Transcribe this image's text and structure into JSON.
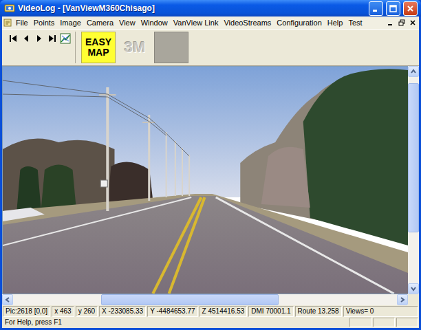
{
  "window": {
    "title": "VideoLog - [VanViewM360Chisago]"
  },
  "menu": [
    "File",
    "Points",
    "Image",
    "Camera",
    "View",
    "Window",
    "VanView Link",
    "VideoStreams",
    "Configuration",
    "Help",
    "Test"
  ],
  "toolbar_buttons": [
    {
      "label": "EASY MAP",
      "kind": "highlight"
    },
    {
      "label": "3M",
      "kind": "logo"
    },
    {
      "label": "",
      "kind": "blank"
    }
  ],
  "vertical_scrollbar": {
    "start": 0.03,
    "level": 0.72
  },
  "horizontal_scrollbar": {
    "start": 0.23,
    "level": 0.46
  },
  "status_bar": {
    "fields": [
      "Pic:2618 [0,0]",
      "x 463",
      "y 260",
      "X -233085.33",
      "Y -4484653.77",
      "Z 4514416.53",
      "DMI 70001.1",
      "Route 13.258",
      "Views= 0"
    ],
    "help": "For Help, press F1"
  }
}
